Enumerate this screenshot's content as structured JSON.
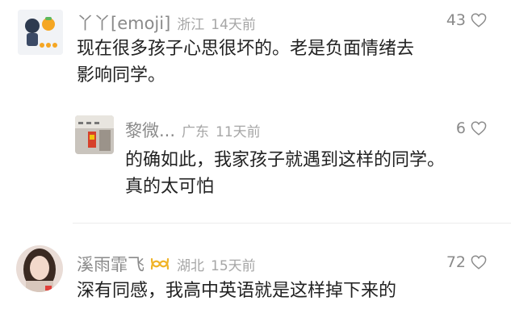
{
  "comments": [
    {
      "username": "丫丫[emoji]",
      "location": "浙江",
      "time": "14天前",
      "likes": "43",
      "text_lines": [
        "现在很多孩子心思很坏的。老是负面情绪去",
        "影响同学。"
      ],
      "reply": {
        "username": "黎微...",
        "location": "广东",
        "time": "11天前",
        "likes": "6",
        "text_lines": [
          "的确如此，我家孩子就遇到这样的同学。",
          "真的太可怕"
        ]
      }
    },
    {
      "username": "溪雨霏飞",
      "badge_icon": "double-loop-badge-icon",
      "location": "湖北",
      "time": "15天前",
      "likes": "72",
      "text_lines": [
        "深有同感，我高中英语就是这样掉下来的"
      ]
    }
  ],
  "colors": {
    "username": "#8a8a8a",
    "meta": "#a6a6a6",
    "text": "#222222",
    "badge": "#f0b429",
    "divider": "#ececec"
  }
}
